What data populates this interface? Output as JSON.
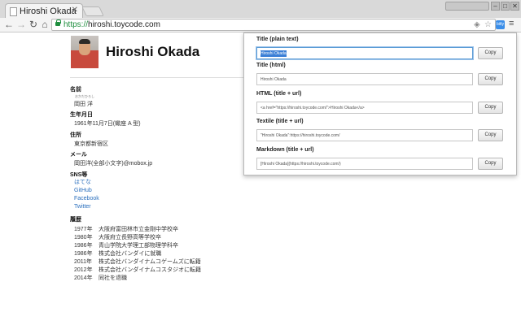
{
  "browser": {
    "tab_title": "Hiroshi Okada",
    "url_scheme": "https://",
    "url_host": "hiroshi.toycode.com",
    "profile_label": "",
    "extension_badge": "bitly"
  },
  "profile": {
    "name": "Hiroshi Okada",
    "sections": {
      "name_label": "名前",
      "name_ruby": "おかだひろし",
      "name_value": "岡田 洋",
      "birth_label": "生年月日",
      "birth_value": "1961年11月7日(蠍座 A 型)",
      "address_label": "住所",
      "address_value": "東京都新宿区",
      "mail_label": "メール",
      "mail_value": "岡田洋(全部小文字)@mobox.jp",
      "sns_label": "SNS等",
      "sns_links": [
        "はてな",
        "GitHub",
        "Facebook",
        "Twitter"
      ],
      "history_label": "履歴",
      "history": [
        {
          "year": "1977年",
          "text": "大阪府富田林市立金剛中学校卒"
        },
        {
          "year": "1980年",
          "text": "大阪府立長野高等学校卒"
        },
        {
          "year": "1986年",
          "text": "青山学院大学理工部物理学科卒"
        },
        {
          "year": "1986年",
          "text": "株式会社バンダイに就職"
        },
        {
          "year": "2011年",
          "text": "株式会社バンダイナムコゲームズに転籍"
        },
        {
          "year": "2012年",
          "text": "株式会社バンダイナムコスタジオに転籍"
        },
        {
          "year": "2014年",
          "text": "同社を退職"
        }
      ]
    }
  },
  "popup": {
    "copy_label": "Copy",
    "items": [
      {
        "label": "Title (plain text)",
        "value": "Hiroshi Okada"
      },
      {
        "label": "Title (html)",
        "value": "Hiroshi Okada"
      },
      {
        "label": "HTML (title + url)",
        "value": "<a href=\"https://hiroshi.toycode.com/\">Hiroshi Okada</a>"
      },
      {
        "label": "Textile (title + url)",
        "value": "\"Hiroshi Okada\":https://hiroshi.toycode.com/"
      },
      {
        "label": "Markdown (title + url)",
        "value": "[Hiroshi Okada](https://hiroshi.toycode.com/)"
      }
    ]
  }
}
